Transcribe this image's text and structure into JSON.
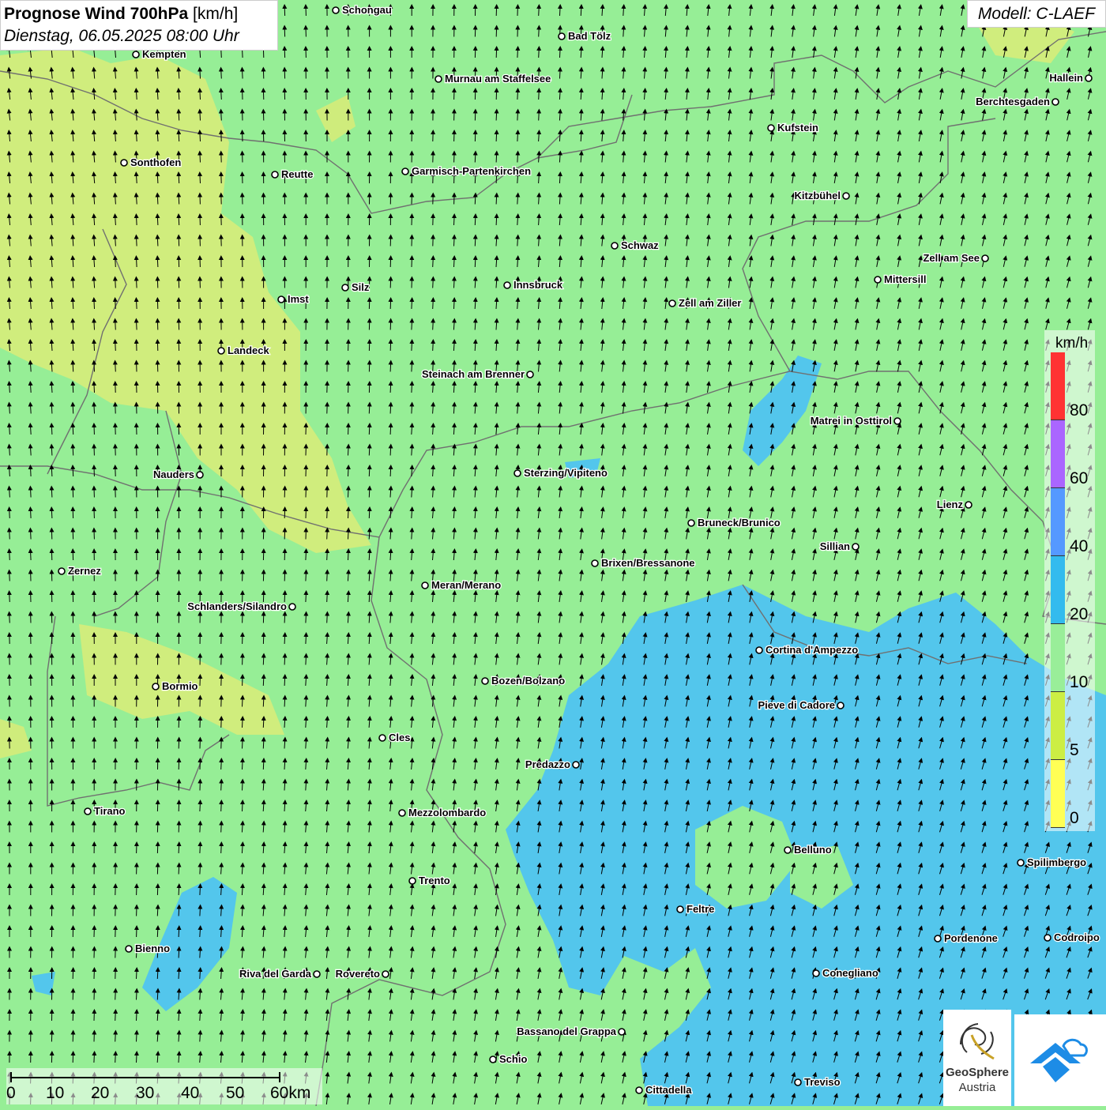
{
  "title": {
    "main": "Prognose Wind 700hPa",
    "unit": "[km/h]",
    "datetime": "Dienstag, 06.05.2025 08:00 Uhr"
  },
  "model": "Modell: C-LAEF",
  "legend": {
    "unit": "km/h",
    "levels": [
      "80",
      "60",
      "40",
      "20",
      "10",
      "5",
      "0"
    ],
    "colors": [
      "#ff3333",
      "#aa66ff",
      "#5599ff",
      "#33bbee",
      "#99ee99",
      "#ccee44",
      "#ffff55"
    ]
  },
  "scalebar": {
    "labels": [
      "0",
      "10",
      "20",
      "30",
      "40",
      "50",
      "60km"
    ]
  },
  "logo": {
    "line1": "GeoSphere",
    "line2": "Austria"
  },
  "colors": {
    "low": "#d6ec7a",
    "mid": "#96ee96",
    "high": "#4fc3f0",
    "border": "#707070"
  },
  "cities": [
    {
      "name": "Schongau"
    },
    {
      "name": "Bad Tölz"
    },
    {
      "name": "Kempten"
    },
    {
      "name": "Murnau am Staffelsee"
    },
    {
      "name": "Hallein"
    },
    {
      "name": "Berchtesgaden"
    },
    {
      "name": "Kufstein"
    },
    {
      "name": "Sonthofen"
    },
    {
      "name": "Reutte"
    },
    {
      "name": "Garmisch-Partenkirchen"
    },
    {
      "name": "Kitzbühel"
    },
    {
      "name": "Schwaz"
    },
    {
      "name": "Zell am See"
    },
    {
      "name": "Mittersill"
    },
    {
      "name": "Imst"
    },
    {
      "name": "Silz"
    },
    {
      "name": "Innsbruck"
    },
    {
      "name": "Zell am Ziller"
    },
    {
      "name": "Landeck"
    },
    {
      "name": "Steinach am Brenner"
    },
    {
      "name": "Matrei in Osttirol"
    },
    {
      "name": "Nauders"
    },
    {
      "name": "Sterzing/Vipiteno"
    },
    {
      "name": "Lienz"
    },
    {
      "name": "Bruneck/Brunico"
    },
    {
      "name": "Sillian"
    },
    {
      "name": "Zernez"
    },
    {
      "name": "Brixen/Bressanone"
    },
    {
      "name": "Meran/Merano"
    },
    {
      "name": "Schlanders/Silandro"
    },
    {
      "name": "Cortina d'Ampezzo"
    },
    {
      "name": "Bozen/Bolzano"
    },
    {
      "name": "Bormio"
    },
    {
      "name": "Pieve di Cadore"
    },
    {
      "name": "Cles"
    },
    {
      "name": "Predazzo"
    },
    {
      "name": "Tirano"
    },
    {
      "name": "Mezzolombardo"
    },
    {
      "name": "Belluno"
    },
    {
      "name": "Spilimbergo"
    },
    {
      "name": "Trento"
    },
    {
      "name": "Feltre"
    },
    {
      "name": "Pordenone"
    },
    {
      "name": "Codroipo"
    },
    {
      "name": "Bienno"
    },
    {
      "name": "Riva del Garda"
    },
    {
      "name": "Rovereto"
    },
    {
      "name": "Conegliano"
    },
    {
      "name": "Bassano del Grappa"
    },
    {
      "name": "Schio"
    },
    {
      "name": "Treviso"
    },
    {
      "name": "Cittadella"
    }
  ]
}
